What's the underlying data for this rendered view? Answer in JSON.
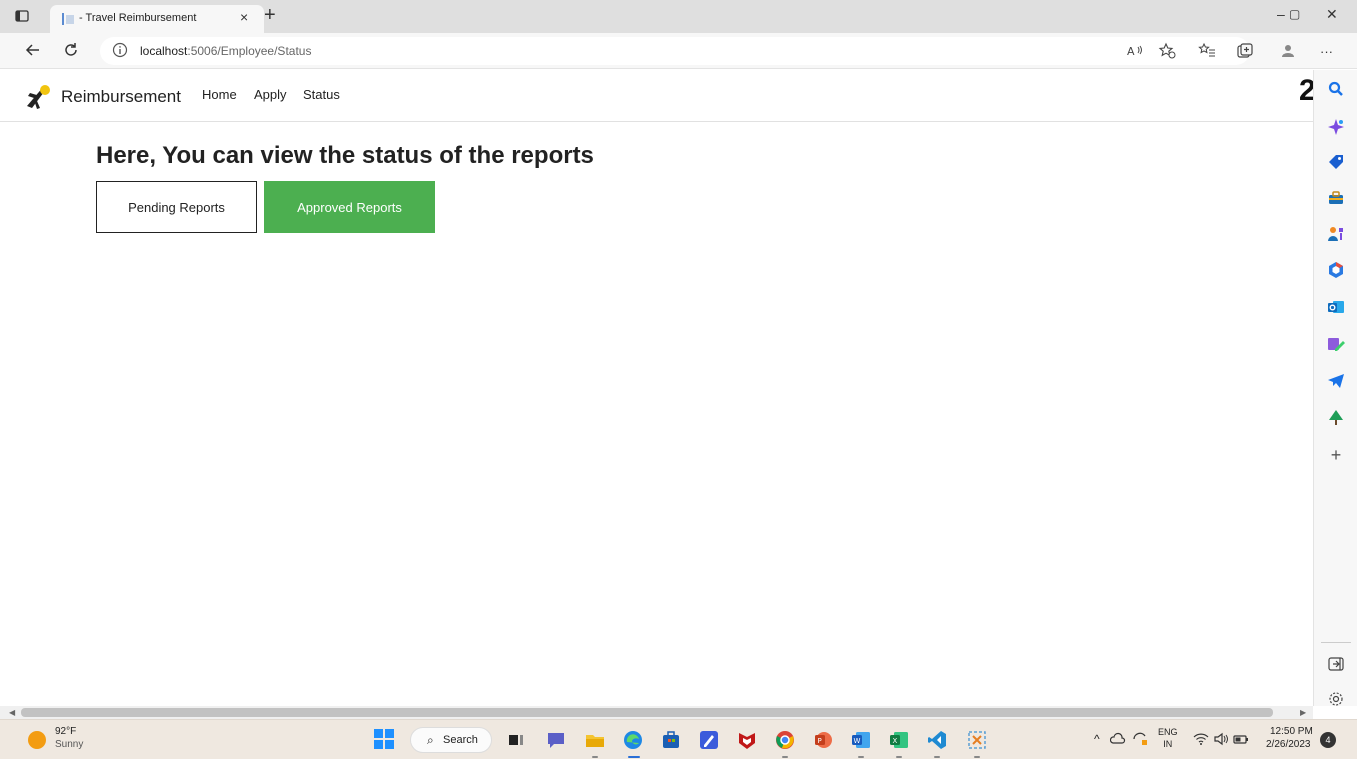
{
  "browser": {
    "tab_title": "- Travel Reimbursement",
    "tab_close": "×",
    "new_tab": "+",
    "window_controls": {
      "minimize": "–",
      "restore": "▢",
      "close": "✕"
    },
    "url_host": "localhost",
    "url_path": ":5006/Employee/Status",
    "more_label": "···"
  },
  "site": {
    "brand": "Reimbursement",
    "nav": [
      "Home",
      "Apply",
      "Status"
    ],
    "cut_edge_glyph": "2"
  },
  "main": {
    "heading": "Here, You can view the status of the reports",
    "pending_button": "Pending Reports",
    "approved_button": "Approved Reports",
    "approved_color": "#4caf50"
  },
  "sidebar": {
    "add_label": "+",
    "icons": [
      "search-icon",
      "copilot-icon",
      "shopping-tag-icon",
      "tools-icon",
      "games-icon",
      "office-icon",
      "outlook-icon",
      "designer-icon",
      "telegram-icon",
      "tree-icon"
    ]
  },
  "taskbar": {
    "weather_temp": "92°F",
    "weather_cond": "Sunny",
    "search_label": "Search",
    "lang_top": "ENG",
    "lang_bottom": "IN",
    "time": "12:50 PM",
    "date": "2/26/2023",
    "notifications": "4"
  }
}
